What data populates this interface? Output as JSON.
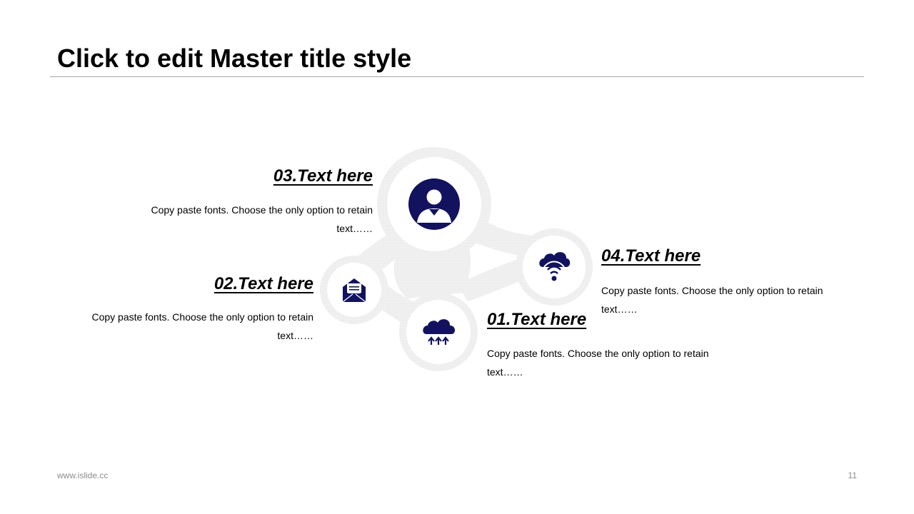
{
  "slide": {
    "title": "Click to edit Master title style",
    "accent_color": "#12125e",
    "ring_color": "#efefef"
  },
  "items": [
    {
      "number_label": "01.Text here",
      "body": "Copy paste fonts. Choose the only option to retain text……",
      "icon": "cloud-upload-icon"
    },
    {
      "number_label": "02.Text here",
      "body": "Copy paste fonts. Choose the only option to retain text……",
      "icon": "envelope-open-icon"
    },
    {
      "number_label": "03.Text here",
      "body": "Copy paste fonts. Choose the only option to retain text……",
      "icon": "user-avatar-icon"
    },
    {
      "number_label": "04.Text here",
      "body": "Copy paste fonts. Choose the only option to retain text……",
      "icon": "cloud-wifi-icon"
    }
  ],
  "footer": {
    "website": "www.islide.cc",
    "page_number": "11"
  }
}
